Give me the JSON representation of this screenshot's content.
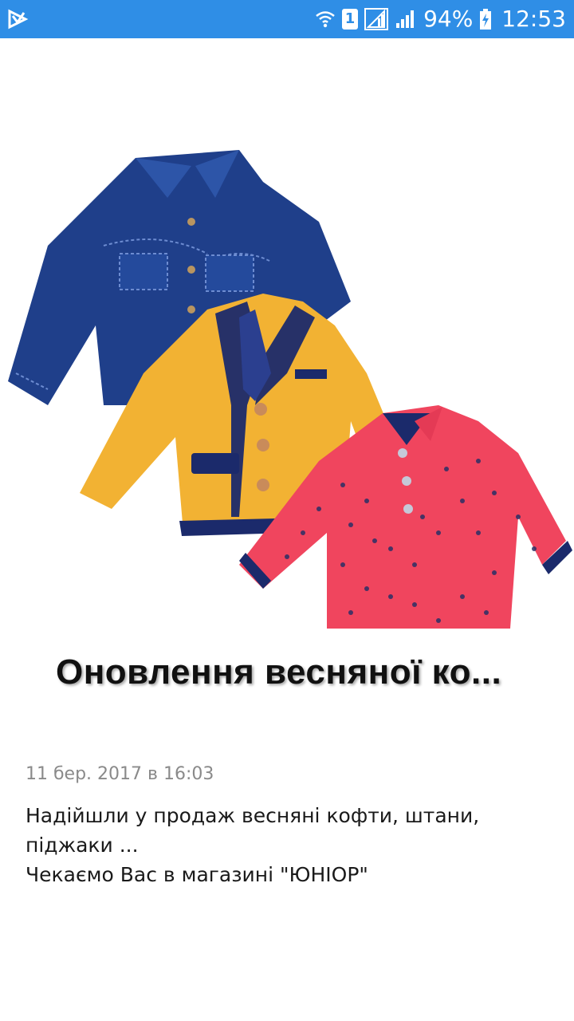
{
  "status_bar": {
    "sim_label": "1",
    "battery_percent": "94%",
    "time": "12:53",
    "icons": [
      "app-notification-icon",
      "wifi-icon",
      "sim-icon",
      "signal-icon",
      "signal-icon",
      "battery-charging-icon"
    ]
  },
  "hero": {
    "title": "Оновлення весняної ко...",
    "image": "kids-jackets"
  },
  "post": {
    "date": "11 бер. 2017 в 16:03",
    "lines": [
      "Надійшли у продаж весняні кофти, штани, піджаки ...",
      "Чекаємо Вас в магазині \"ЮНІОР\""
    ]
  },
  "colors": {
    "status_bar": "#2f8ee6",
    "denim": "#1f3f8a",
    "mustard": "#f2b233",
    "navy_trim": "#1b2a6b",
    "pink": "#f0455e"
  }
}
